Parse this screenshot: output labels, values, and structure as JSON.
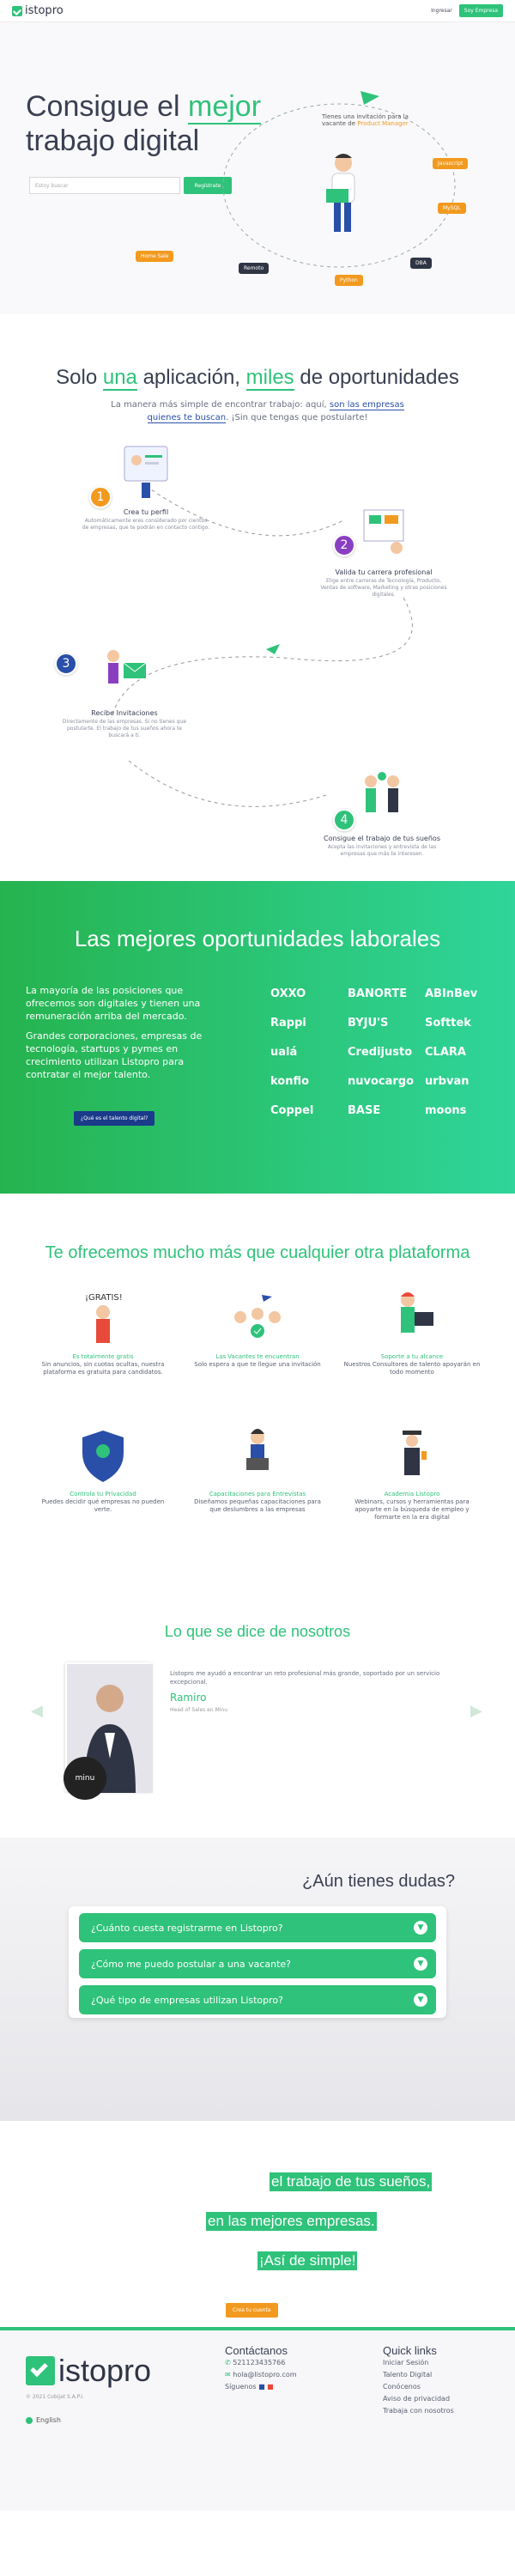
{
  "header": {
    "logo": "istopro",
    "login": "Ingresar",
    "employers": "Soy Empresa"
  },
  "hero": {
    "title_pre": "Consigue el ",
    "title_hl": "mejor",
    "title_post": "trabajo digital",
    "search_placeholder": "Estoy buscar",
    "search_button": "Regístrate",
    "notif": "Tienes una invitación para la vacante de",
    "notif_role": "Product Manager",
    "skills": [
      "Javascript",
      "MySQL",
      "DBA",
      "Python",
      "Remoto",
      "Home Sale"
    ],
    "skill_colors": [
      "#f29a1f",
      "#f29a1f",
      "#2f3545",
      "#f29a1f",
      "#2f3545",
      "#f29a1f"
    ]
  },
  "how": {
    "title_a": "Solo ",
    "title_b": "una",
    "title_c": " aplicación, ",
    "title_d": "miles",
    "title_e": " de oportunidades",
    "sub_a": "La manera más simple de encontrar trabajo: aquí, ",
    "sub_b": "son las empresas quienes te buscan",
    "sub_c": ". ¡Sin que tengas que postularte!",
    "steps": [
      {
        "n": "1",
        "t": "Crea tu perfil",
        "d": "Automáticamente eres considerado por cientos de empresas, que te podrán en contacto contigo."
      },
      {
        "n": "2",
        "t": "Valida tu carrera profesional",
        "d": "Elige entre carreras de Tecnología, Producto, Ventas de software, Marketing y otras posiciones digitales."
      },
      {
        "n": "3",
        "t": "Recibe Invitaciones",
        "d": "Directamente de las empresas. Si no tienes que postularte. El trabajo de tus sueños ahora te buscará a ti."
      },
      {
        "n": "4",
        "t": "Consigue el trabajo de tus sueños",
        "d": "Acepta las invitaciones y entrevista de las empresas que más te interesen."
      }
    ],
    "step_colors": [
      "#f29a1f",
      "#8a3fc2",
      "#2a4fa8",
      "#2fc27a"
    ]
  },
  "opps": {
    "title": "Las mejores oportunidades laborales",
    "p1": "La mayoría de las posiciones que ofrecemos son digitales y tienen una remuneración arriba del mercado.",
    "p2": "Grandes corporaciones, empresas de tecnología, startups y pymes en crecimiento utilizan Listopro para contratar el mejor talento.",
    "button": "¿Qué es el talento digital?",
    "logos": [
      "OXXO",
      "BANORTE",
      "ABInBev",
      "Rappi",
      "BYJU'S",
      "Softtek",
      "ualá",
      "Credijusto",
      "CLARA",
      "konfio",
      "nuvocargo",
      "urbvan",
      "Coppel",
      "BASE",
      "moons"
    ]
  },
  "offer": {
    "title": "Te ofrecemos mucho más que cualquier otra plataforma",
    "features": [
      {
        "t": "Es totalmente gratis",
        "d": "Sin anuncios, sin cuotas ocultas, nuestra plataforma es gratuita para candidatos.",
        "badge": "¡GRATIS!"
      },
      {
        "t": "Las Vacantes te encuentran",
        "d": "Solo espera a que te llegue una invitación"
      },
      {
        "t": "Soporte a tu alcance",
        "d": "Nuestros Consultores de talento apoyarán en todo momento"
      },
      {
        "t": "Controla tu Privacidad",
        "d": "Puedes decidir qué empresas no pueden verte."
      },
      {
        "t": "Capacitaciones para Entrevistas",
        "d": "Diseñamos pequeñas capacitaciones para que deslumbres a las empresas"
      },
      {
        "t": "Academia Listopro",
        "d": "Webinars, cursos y herramientas para apoyarte en la búsqueda de empleo y formarte en la era digital"
      }
    ]
  },
  "testimonials": {
    "title": "Lo que se dice de nosotros",
    "quote": "Listopro me ayudó a encontrar un reto profesional más grande, soportado por un servicio excepcional.",
    "name": "Ramiro",
    "role": "Head of Sales en Minu",
    "company_badge": "minu"
  },
  "faq": {
    "title": "¿Aún tienes dudas?",
    "questions": [
      "¿Cuánto cuesta registrarme en Listopro?",
      "¿Cómo me puedo postular a una vacante?",
      "¿Qué tipo de empresas utilizan Listopro?"
    ]
  },
  "cta": {
    "l1": "el trabajo de tus sueños,",
    "l2": "en las mejores empresas.",
    "l3": "¡Así de simple!",
    "button": "Crea tu cuenta"
  },
  "footer": {
    "logo": "istopro",
    "copyright": "© 2021 Cobijat S.A.P.I.",
    "lang": "English",
    "contact_title": "Contáctanos",
    "phone": "521123435766",
    "email": "hola@listopro.com",
    "follow": "Síguenos",
    "links_title": "Quick links",
    "links": [
      "Iniciar Sesión",
      "Talento Digital",
      "Conócenos",
      "Aviso de privacidad",
      "Trabaja con nosotros"
    ]
  }
}
